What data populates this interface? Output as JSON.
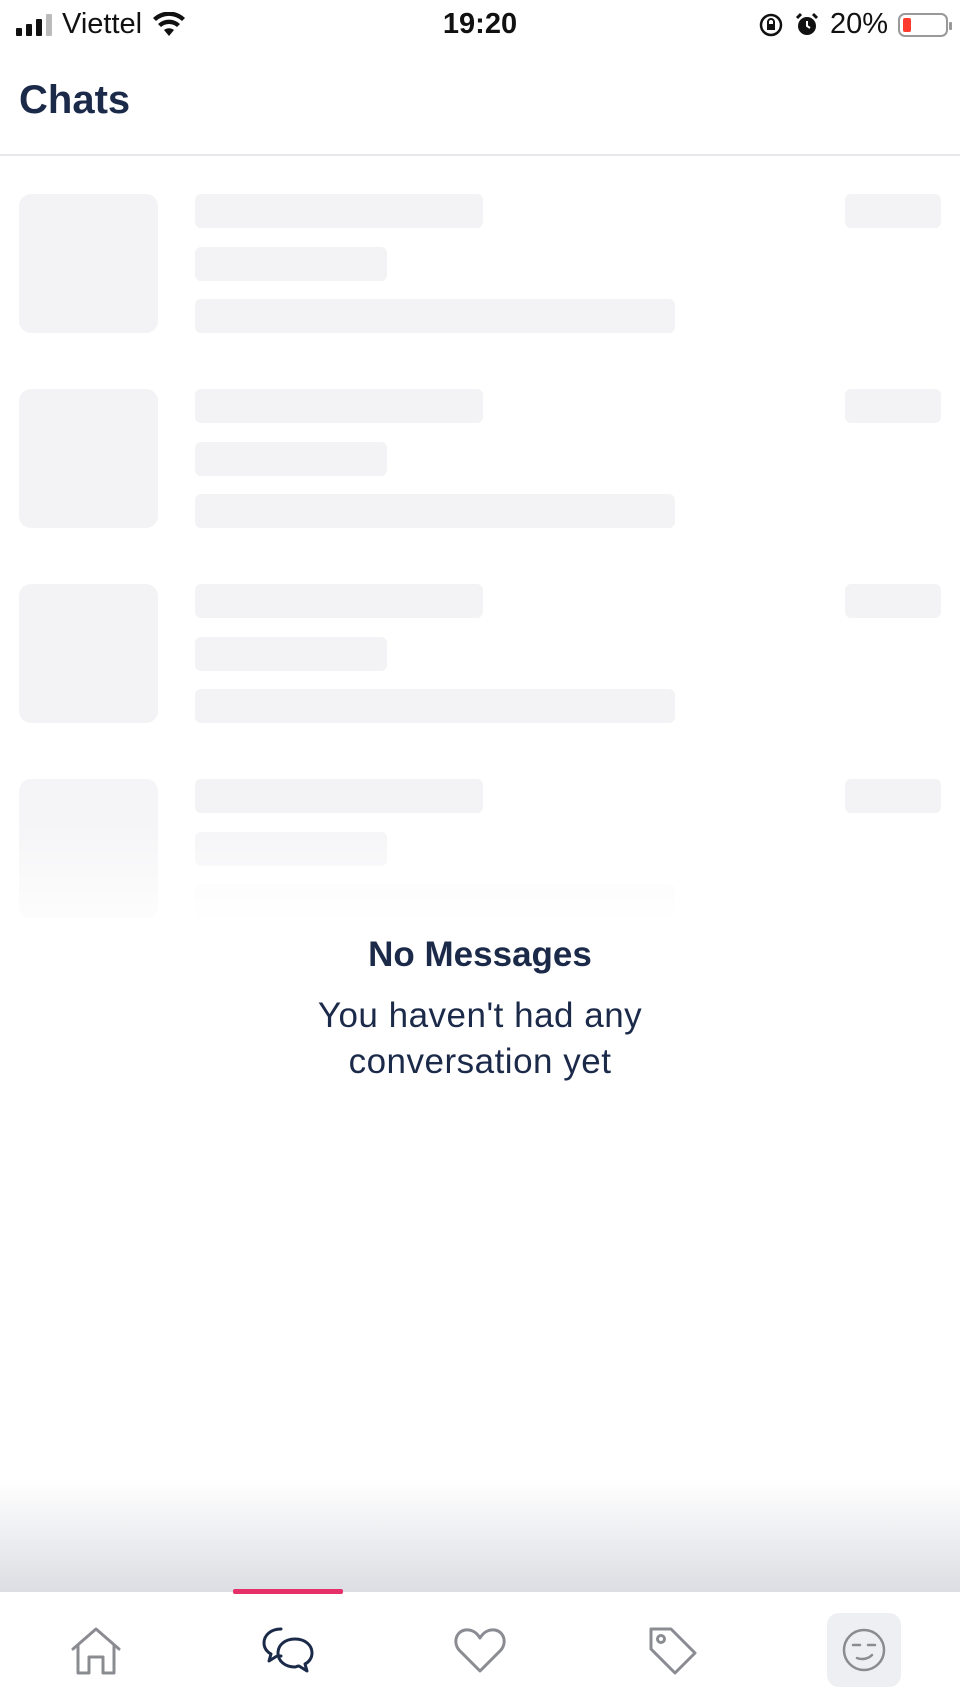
{
  "status_bar": {
    "carrier": "Viettel",
    "time": "19:20",
    "battery_percent": "20%",
    "battery_level": 0.2,
    "icons": [
      "signal-icon",
      "wifi-icon",
      "rotation-lock-icon",
      "alarm-icon",
      "battery-icon"
    ]
  },
  "header": {
    "title": "Chats"
  },
  "empty_state": {
    "title": "No Messages",
    "subtitle": "You haven't had any conversation yet"
  },
  "tab_bar": {
    "active_tab": "chats",
    "accent_color": "#e6306a",
    "tabs": [
      {
        "id": "home",
        "icon": "home-icon"
      },
      {
        "id": "chats",
        "icon": "chat-bubbles-icon"
      },
      {
        "id": "favorites",
        "icon": "heart-icon"
      },
      {
        "id": "deals",
        "icon": "tag-icon"
      },
      {
        "id": "profile",
        "icon": "wink-face-icon"
      }
    ]
  },
  "colors": {
    "title_text": "#1c2a4a",
    "skeleton": "#f3f3f5",
    "battery_low": "#ff3b30"
  }
}
